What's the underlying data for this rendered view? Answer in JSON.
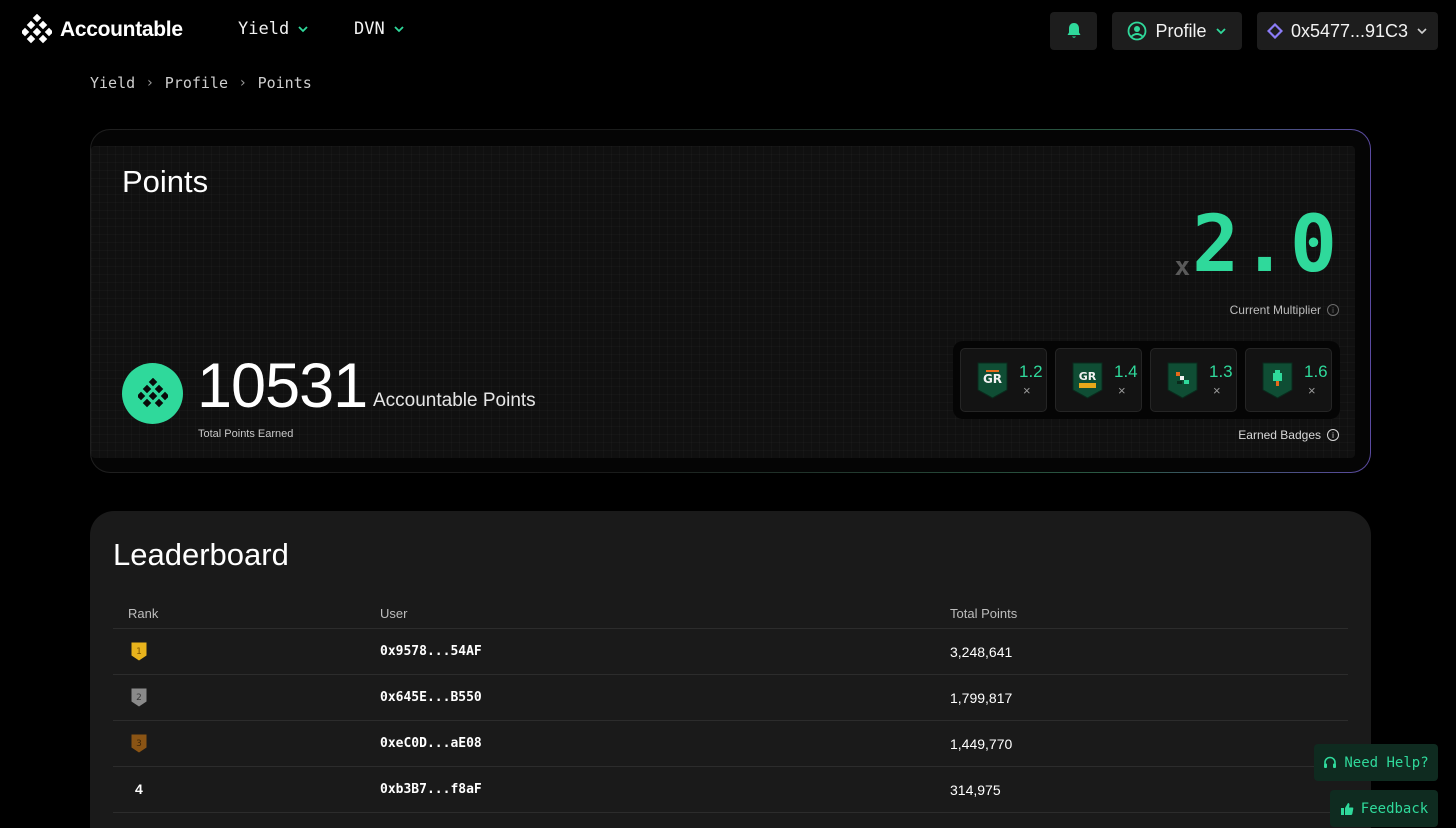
{
  "header": {
    "brand": "Accountable",
    "nav": [
      {
        "label": "Yield",
        "icon": "chevron-down-icon"
      },
      {
        "label": "DVN",
        "icon": "chevron-down-icon"
      }
    ],
    "notifications_icon": "bell-icon",
    "profile_label": "Profile",
    "wallet_label": "0x5477...91C3"
  },
  "breadcrumb": [
    "Yield",
    "Profile",
    "Points"
  ],
  "points": {
    "title": "Points",
    "multiplier_prefix": "x",
    "multiplier": "2.0",
    "multiplier_label": "Current Multiplier",
    "total": "10531",
    "unit": "Accountable Points",
    "total_label": "Total Points Earned",
    "badges_label": "Earned Badges",
    "badges": [
      {
        "value": "1.2",
        "suffix": "×"
      },
      {
        "value": "1.4",
        "suffix": "×"
      },
      {
        "value": "1.3",
        "suffix": "×"
      },
      {
        "value": "1.6",
        "suffix": "×"
      }
    ]
  },
  "leaderboard": {
    "title": "Leaderboard",
    "columns": [
      "Rank",
      "User",
      "Total Points"
    ],
    "rows": [
      {
        "rank": "1",
        "user": "0x9578...54AF",
        "points": "3,248,641"
      },
      {
        "rank": "2",
        "user": "0x645E...B550",
        "points": "1,799,817"
      },
      {
        "rank": "3",
        "user": "0xeC0D...aE08",
        "points": "1,449,770"
      },
      {
        "rank": "4",
        "user": "0xb3B7...f8aF",
        "points": "314,975"
      }
    ]
  },
  "floating": {
    "help_label": "Need Help?",
    "feedback_label": "Feedback"
  },
  "colors": {
    "accent": "#2fd99b",
    "background": "#000000",
    "card": "#1a1a1a",
    "gold": "#e8b31c",
    "silver": "#8a8a8a",
    "bronze": "#8a5414",
    "wallet_icon": "#8b7cf6"
  }
}
